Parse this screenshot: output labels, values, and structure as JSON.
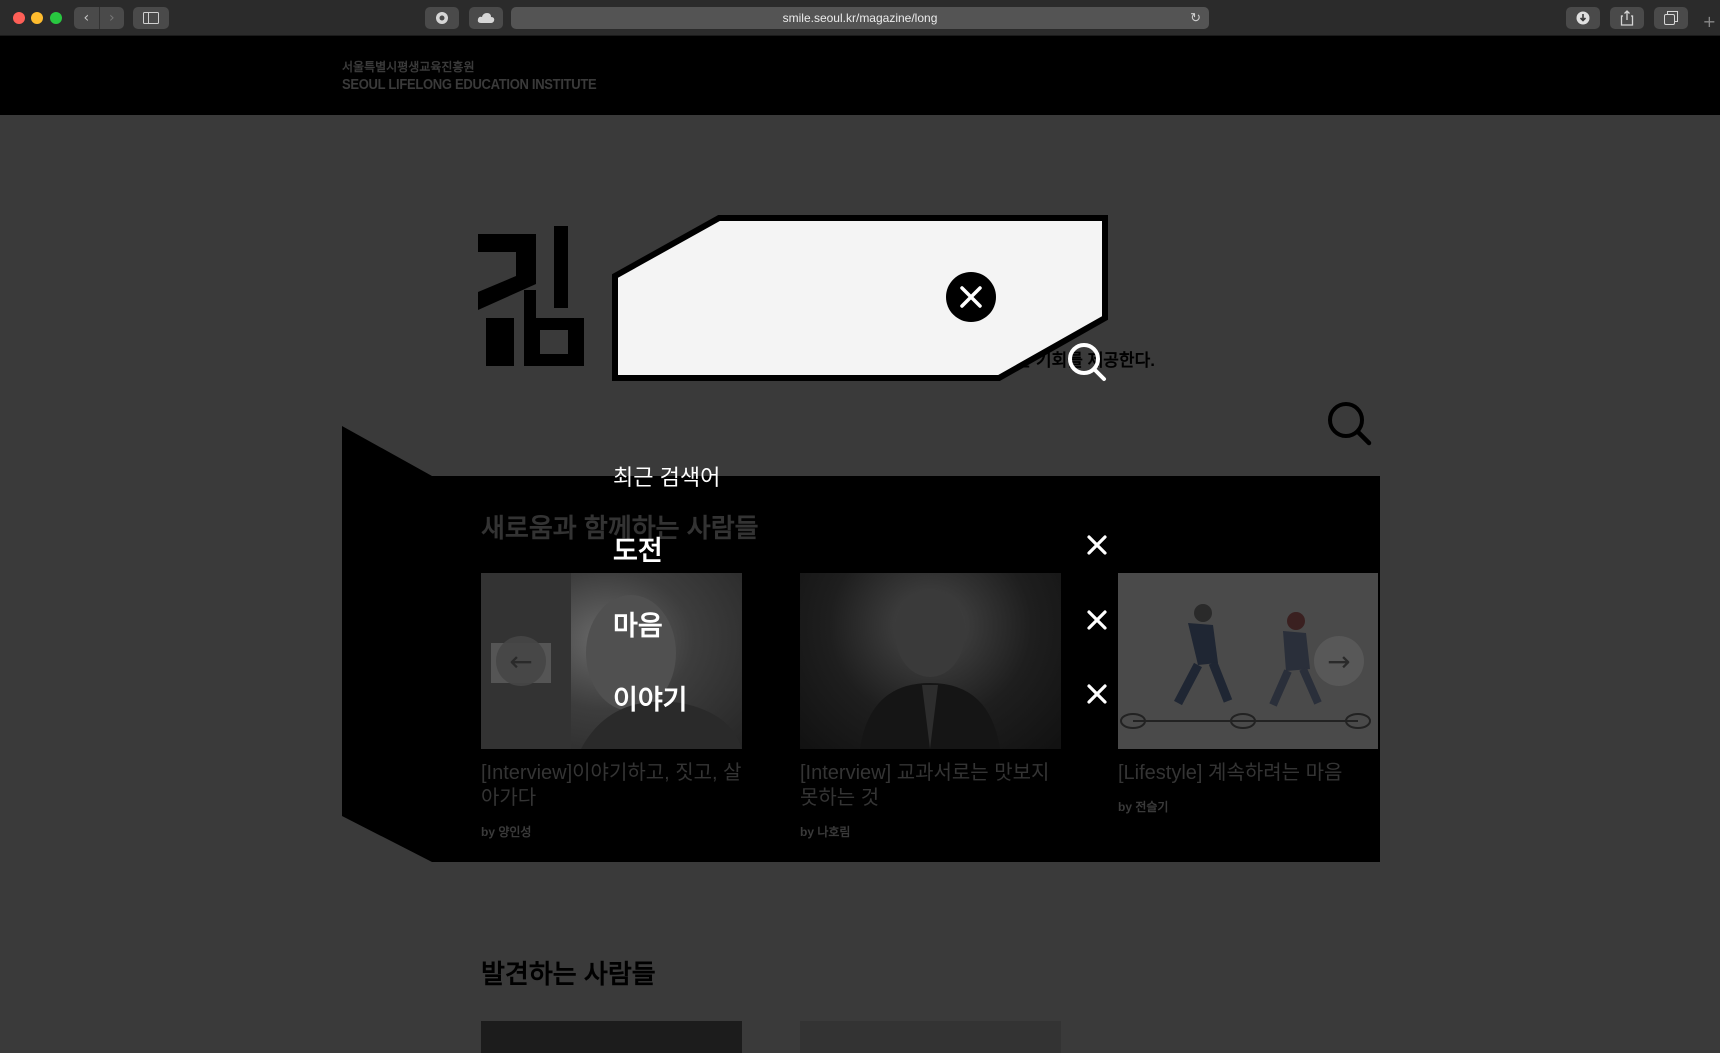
{
  "browser": {
    "url": "smile.seoul.kr/magazine/long"
  },
  "site": {
    "logo_korean": "서울특별시평생교육진흥원",
    "logo_english": "SEOUL LIFELONG EDUCATION INSTITUTE",
    "hero_tagline": "하는 기회를 제공한다."
  },
  "sections": {
    "featured_title": "새로움과 함께하는 사람들",
    "discover_title": "발견하는 사람들"
  },
  "cards": [
    {
      "title": "[Interview]이야기하고, 짓고, 살아가다",
      "author": "by 양인성"
    },
    {
      "title": "[Interview] 교과서로는 맛보지 못하는 것",
      "author": "by 나호림"
    },
    {
      "title": "[Lifestyle] 계속하려는 마음",
      "author": "by 전슬기"
    }
  ],
  "search_overlay": {
    "input_value": "",
    "recent_heading": "최근 검색어",
    "recent_terms": [
      "도전",
      "마음",
      "이야기"
    ]
  },
  "icons": {
    "close": "close-icon",
    "search": "search-icon",
    "arrow_left": "arrow-left-icon",
    "arrow_right": "arrow-right-icon"
  },
  "colors": {
    "overlay": "#000000",
    "search_box_fill": "#f4f4f4",
    "text_on_overlay": "#ffffff"
  }
}
